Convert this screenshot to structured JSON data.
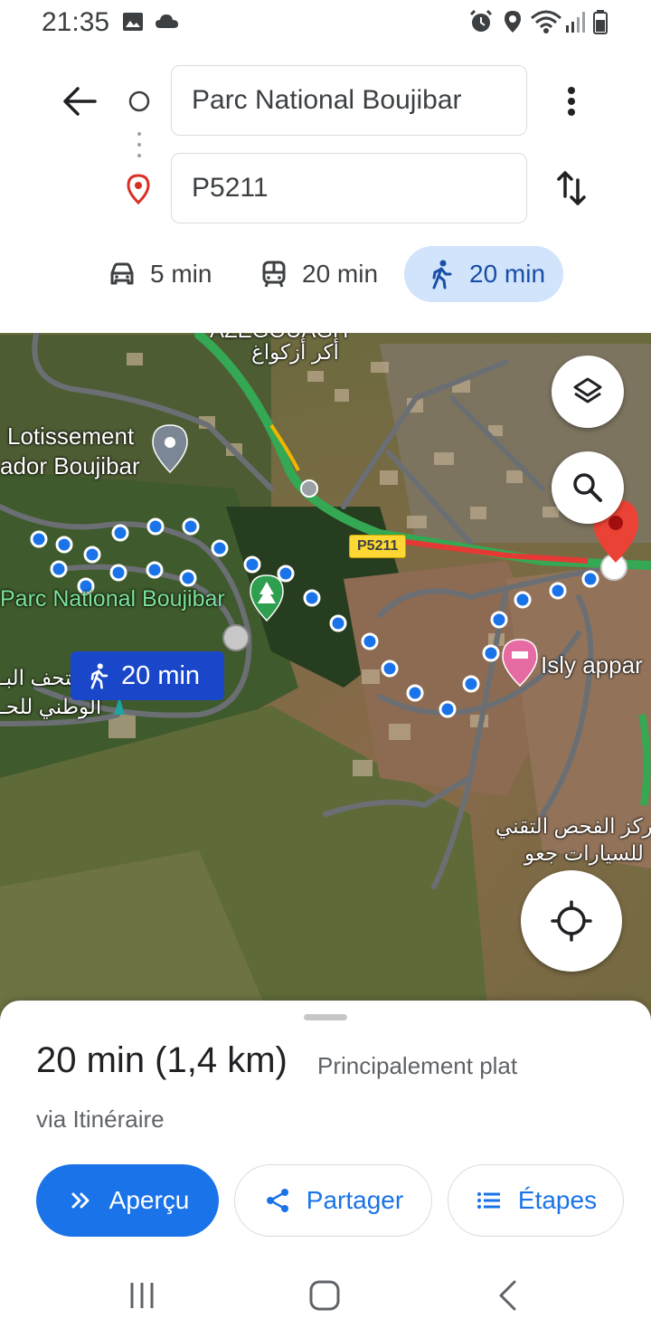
{
  "status_bar": {
    "time": "21:35",
    "left_icons": [
      "gallery-icon",
      "cloud-icon"
    ],
    "right_icons": [
      "alarm-icon",
      "location-icon",
      "wifi-icon",
      "signal-icon",
      "battery-icon"
    ]
  },
  "directions": {
    "origin": "Parc National Boujibar",
    "destination": "P5211"
  },
  "modes": [
    {
      "name": "car",
      "icon": "car-icon",
      "label": "5 min",
      "selected": false
    },
    {
      "name": "transit",
      "icon": "transit-icon",
      "label": "20 min",
      "selected": false
    },
    {
      "name": "walk",
      "icon": "walk-icon",
      "label": "20 min",
      "selected": true
    }
  ],
  "map": {
    "labels": {
      "top_arabic": "أكر أزكواغ",
      "top_latin": "AZEGOUAGH",
      "lotissement_line1": "Lotissement",
      "lotissement_line2": "ador Boujibar",
      "park": "Parc National Boujibar",
      "museum_ar_line1": "متحف البـ",
      "museum_ar_line2": "الوطني للحـ",
      "isly": "Isly appar",
      "center_ar_line1": "مركز الفحص التقني",
      "center_ar_line2": "للسيارات جعو"
    },
    "road_badge": "P5211",
    "duration_tag": "20 min",
    "colors": {
      "route_dot": "#1a73e8",
      "traffic_red": "#e53935",
      "traffic_green": "#34a853",
      "destination_pin": "#ea4335"
    }
  },
  "sheet": {
    "duration": "20 min (1,4 km)",
    "terrain": "Principalement plat",
    "via": "via Itinéraire",
    "buttons": {
      "preview": "Aperçu",
      "share": "Partager",
      "steps": "Étapes"
    }
  },
  "nav": [
    "recents-icon",
    "home-icon",
    "back-icon"
  ]
}
